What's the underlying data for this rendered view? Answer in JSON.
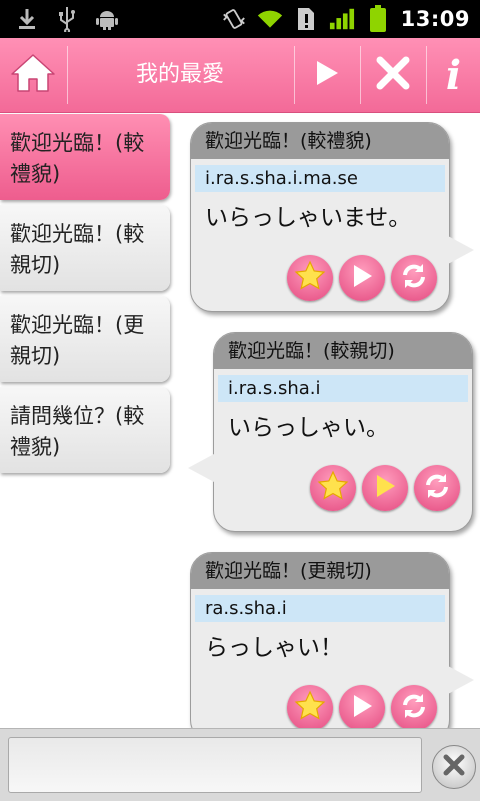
{
  "status_bar": {
    "time": "13:09",
    "icons": [
      "download-icon",
      "usb-icon",
      "android-icon",
      "vibrate-icon",
      "wifi-icon",
      "alert-icon",
      "signal-icon",
      "battery-icon"
    ]
  },
  "header": {
    "title": "我的最愛",
    "info_label": "i"
  },
  "sidebar": {
    "items": [
      {
        "label": "歡迎光臨！(較禮貌)",
        "active": true
      },
      {
        "label": "歡迎光臨！(較親切)",
        "active": false
      },
      {
        "label": "歡迎光臨！(更親切)",
        "active": false
      },
      {
        "label": "請問幾位？(較禮貌)",
        "active": false
      }
    ]
  },
  "cards": [
    {
      "title": "歡迎光臨！(較禮貌)",
      "romanization": "i.ra.s.sha.i.ma.se",
      "japanese": "いらっしゃいませ。"
    },
    {
      "title": "歡迎光臨！(較親切)",
      "romanization": "i.ra.s.sha.i",
      "japanese": "いらっしゃい。"
    },
    {
      "title": "歡迎光臨！(更親切)",
      "romanization": "ra.s.sha.i",
      "japanese": "らっしゃい！"
    }
  ],
  "bottom": {
    "input_value": "",
    "input_placeholder": ""
  },
  "colors": {
    "accent": "#f36a98",
    "accent_light": "#ff90b5",
    "highlight_blue": "#cde6f7",
    "card_header": "#9a9a9a"
  }
}
